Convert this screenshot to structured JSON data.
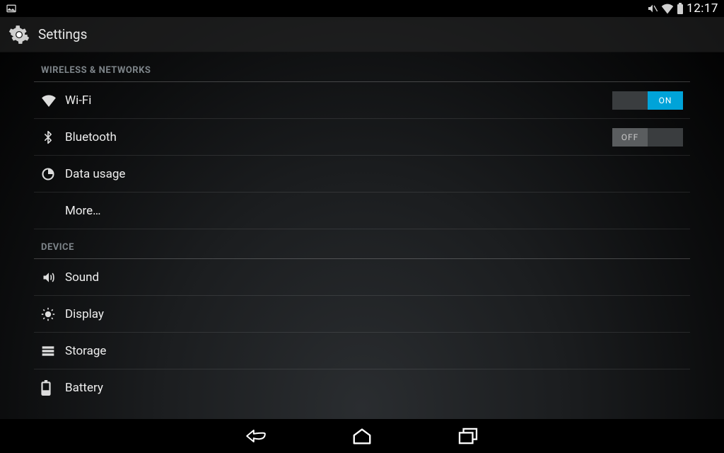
{
  "status": {
    "time": "12:17"
  },
  "actionbar": {
    "title": "Settings"
  },
  "toggle": {
    "on_label": "ON",
    "off_label": "OFF"
  },
  "sections": {
    "wireless": {
      "header": "WIRELESS & NETWORKS",
      "wifi": {
        "label": "Wi-Fi",
        "on": true
      },
      "bluetooth": {
        "label": "Bluetooth",
        "on": false
      },
      "datausage": {
        "label": "Data usage"
      },
      "more": {
        "label": "More…"
      }
    },
    "device": {
      "header": "DEVICE",
      "sound": {
        "label": "Sound"
      },
      "display": {
        "label": "Display"
      },
      "storage": {
        "label": "Storage"
      },
      "battery": {
        "label": "Battery"
      }
    }
  }
}
